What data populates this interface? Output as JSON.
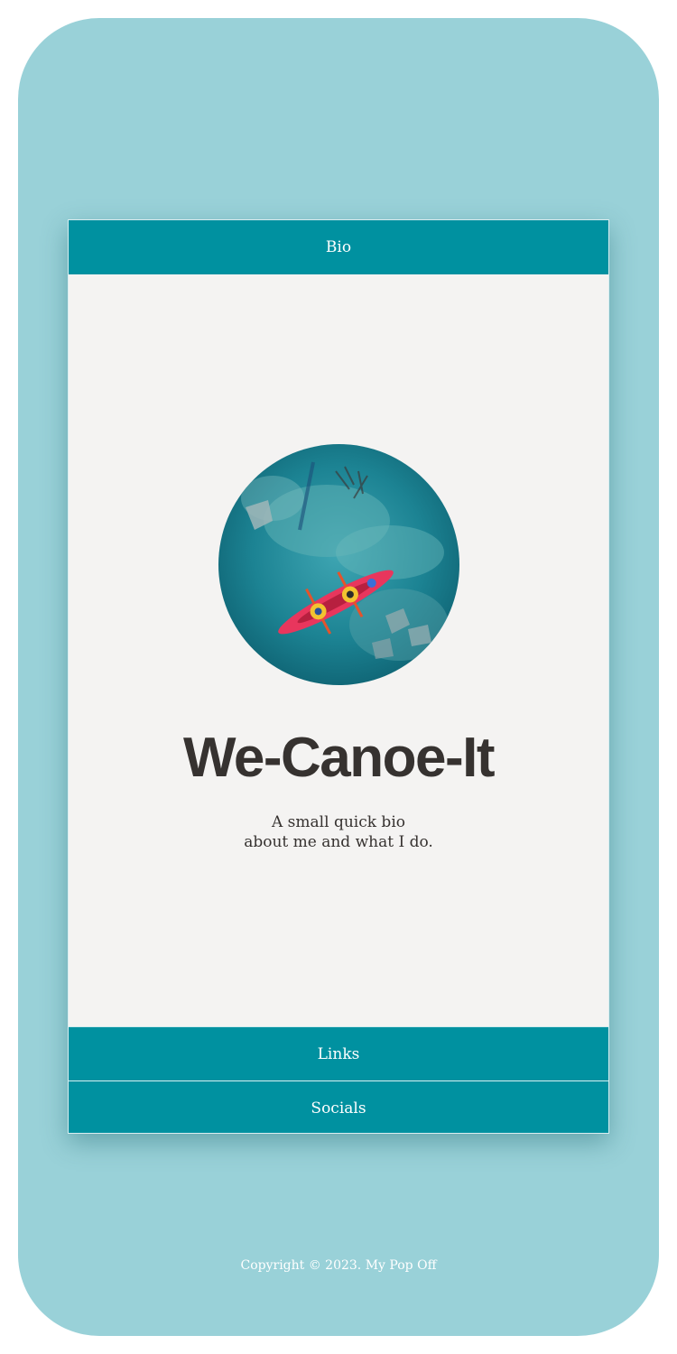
{
  "tabs": {
    "bio_label": "Bio",
    "links_label": "Links",
    "socials_label": "Socials"
  },
  "profile": {
    "image_icon": "kayak-photo",
    "title": "We-Canoe-It",
    "bio_line1": "A small quick bio",
    "bio_line2": "about me and what I do."
  },
  "footer": {
    "copyright": "Copyright © 2023. My Pop Off"
  },
  "colors": {
    "background": "#99d1d8",
    "card": "#f4f3f2",
    "accent": "#0091a0",
    "text": "#363230"
  }
}
